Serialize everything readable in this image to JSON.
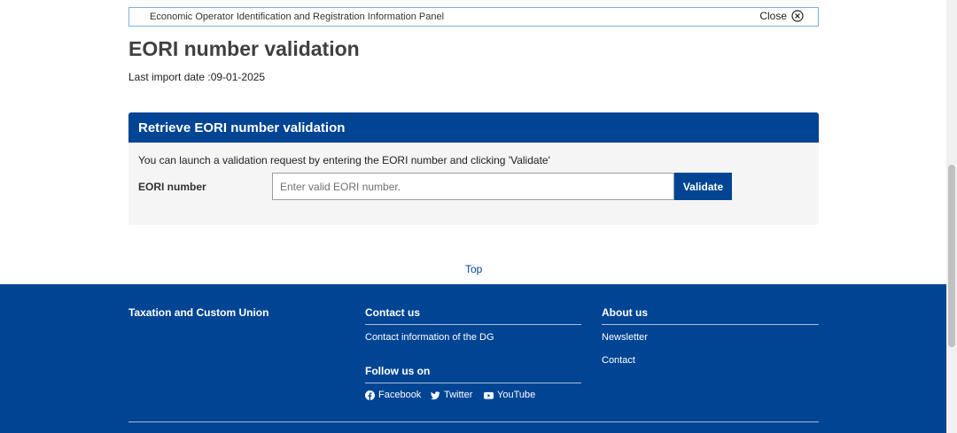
{
  "info_panel": {
    "text": "Economic Operator Identification and Registration Information Panel",
    "close_label": "Close"
  },
  "page": {
    "title": "EORI number validation",
    "last_import": "Last import date :09-01-2025"
  },
  "card": {
    "title": "Retrieve EORI number validation",
    "description": "You can launch a validation request by entering the EORI number and clicking 'Validate'",
    "field_label": "EORI number",
    "input_placeholder": "Enter valid EORI number.",
    "input_value": "",
    "button_label": "Validate"
  },
  "top_link": "Top",
  "footer": {
    "col1": {
      "heading": "Taxation and Custom Union"
    },
    "col2": {
      "heading": "Contact us",
      "links": [
        "Contact information of the DG"
      ],
      "follow_heading": "Follow us on",
      "social": [
        {
          "label": "Facebook",
          "icon": "facebook-icon"
        },
        {
          "label": "Twitter",
          "icon": "twitter-icon"
        },
        {
          "label": "YouTube",
          "icon": "youtube-icon"
        }
      ]
    },
    "col3": {
      "heading": "About us",
      "links": [
        "Newsletter",
        "Contact"
      ]
    }
  },
  "colors": {
    "brand_blue": "#004494",
    "panel_border": "#7fb2d9",
    "card_bg": "#f5f5f5"
  }
}
